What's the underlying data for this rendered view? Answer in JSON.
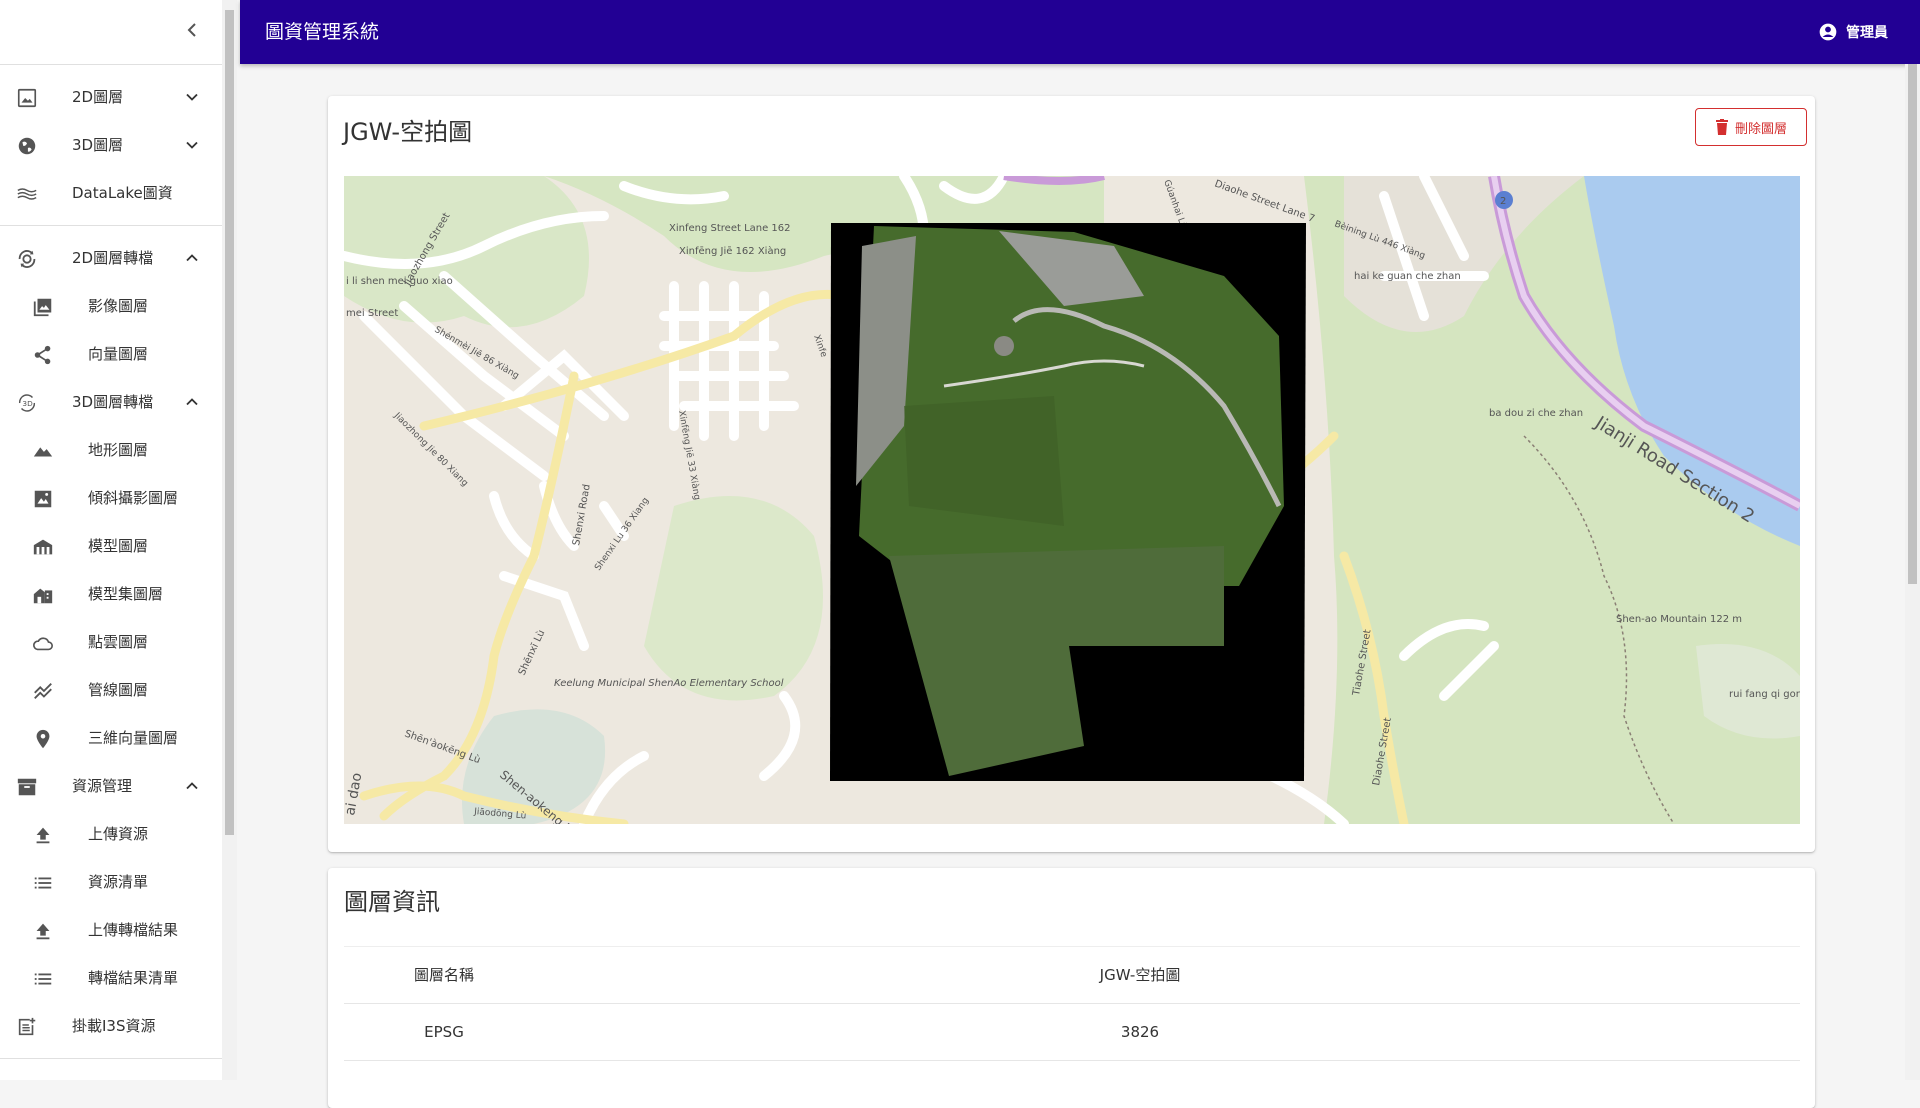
{
  "app": {
    "title": "圖資管理系統",
    "user_label": "管理員"
  },
  "sidebar": {
    "items": [
      {
        "label": "2D圖層",
        "icon": "image-icon"
      },
      {
        "label": "3D圖層",
        "icon": "globe-icon"
      },
      {
        "label": "DataLake圖資",
        "icon": "waves-icon"
      },
      {
        "label": "2D圖層轉檔",
        "icon": "rotate-2d-icon"
      },
      {
        "label": "影像圖層",
        "icon": "photo-library-icon"
      },
      {
        "label": "向量圖層",
        "icon": "share-nodes-icon"
      },
      {
        "label": "3D圖層轉檔",
        "icon": "rotate-3d-icon"
      },
      {
        "label": "地形圖層",
        "icon": "terrain-icon"
      },
      {
        "label": "傾斜攝影圖層",
        "icon": "photo-icon"
      },
      {
        "label": "模型圖層",
        "icon": "building-icon"
      },
      {
        "label": "模型集圖層",
        "icon": "buildings-icon"
      },
      {
        "label": "點雲圖層",
        "icon": "cloud-icon"
      },
      {
        "label": "管線圖層",
        "icon": "pipeline-icon"
      },
      {
        "label": "三維向量圖層",
        "icon": "location-pin-icon"
      },
      {
        "label": "資源管理",
        "icon": "archive-icon"
      },
      {
        "label": "上傳資源",
        "icon": "upload-icon"
      },
      {
        "label": "資源清單",
        "icon": "list-icon"
      },
      {
        "label": "上傳轉檔結果",
        "icon": "upload-icon"
      },
      {
        "label": "轉檔結果清單",
        "icon": "list-icon"
      },
      {
        "label": "掛載I3S資源",
        "icon": "post-add-icon"
      }
    ]
  },
  "layer": {
    "title": "JGW-空拍圖",
    "delete_label": "刪除圖層"
  },
  "map": {
    "labels": [
      "Xinfeng Street Lane 162",
      "Xinfēng Jiē 162 Xiàng",
      "Jiaozhong Street",
      "Shenxi Road",
      "Shēnxī Lù",
      "Keelung Municipal ShenAo Elementary School",
      "Shēn'àokēng Lù",
      "Shen-aokeng Road",
      "Tiaohe Street",
      "Diaohe Street",
      "Jianji Road Section 2",
      "hai ke guan che zhan",
      "ba dou zi che zhan",
      "Shen-ao Mountain 122 m",
      "rui fang qi gong",
      "Diaohe Street Lane 7",
      "Bèining Lù 446 Xiàng",
      "Shenxi Lu 36 Xiang",
      "Jiaozhong Jie 80 Xiang",
      "Shénmèi Jiē 86 Xiàng",
      "Xinfēng Jiē 33 Xiàng",
      "Jiāodōng Lù",
      "i li shen mei guo xiao",
      "mei Street",
      "ai dao",
      "Xinfe",
      "Gúanhai Lù"
    ],
    "route_shield": "2"
  },
  "info": {
    "title": "圖層資訊",
    "rows": [
      {
        "key": "圖層名稱",
        "value": "JGW-空拍圖"
      },
      {
        "key": "EPSG",
        "value": "3826"
      }
    ]
  }
}
